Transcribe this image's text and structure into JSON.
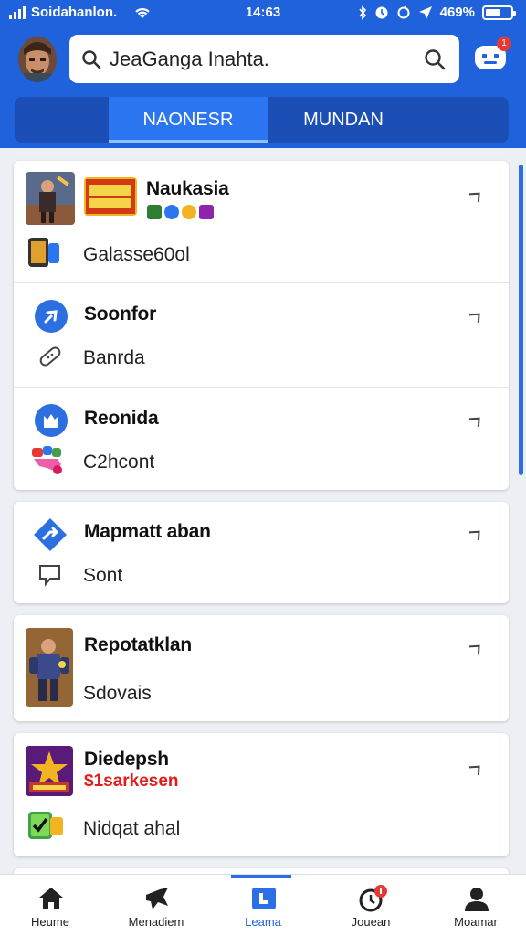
{
  "status_bar": {
    "carrier": "Soidahanlon.",
    "time": "14:63",
    "battery": "469%"
  },
  "header": {
    "search": {
      "value": "JeaGanga Inahta."
    },
    "notification_count": "1",
    "tabs": [
      {
        "label": "NAONESR",
        "active": true
      },
      {
        "label": "MUNDAN",
        "active": false
      }
    ]
  },
  "cards": [
    {
      "items": [
        {
          "title": "Naukasia",
          "subtitle": "Galasse60ol"
        },
        {
          "title": "Soonfor",
          "subtitle": "Banrda"
        },
        {
          "title": "Reonida",
          "subtitle": "C2hcont"
        }
      ]
    },
    {
      "items": [
        {
          "title": "Mapmatt aban",
          "subtitle": "Sont"
        }
      ]
    },
    {
      "items": [
        {
          "title": "Repotatklan",
          "subtitle": "Sdovais"
        }
      ]
    },
    {
      "items": [
        {
          "title": "Diedepsh",
          "price": "$1sarkesen",
          "subtitle": "Nidqat ahal"
        }
      ]
    }
  ],
  "bottom_nav": [
    {
      "label": "Heume",
      "icon": "home-icon"
    },
    {
      "label": "Menadiem",
      "icon": "megaphone-icon"
    },
    {
      "label": "Leama",
      "icon": "library-icon",
      "active": true
    },
    {
      "label": "Jouean",
      "icon": "clock-icon"
    },
    {
      "label": "Moamar",
      "icon": "person-icon"
    }
  ],
  "colors": {
    "primary": "#1f62dc",
    "accent": "#2b75f0",
    "badge": "#e53935",
    "price": "#e31b1b"
  }
}
